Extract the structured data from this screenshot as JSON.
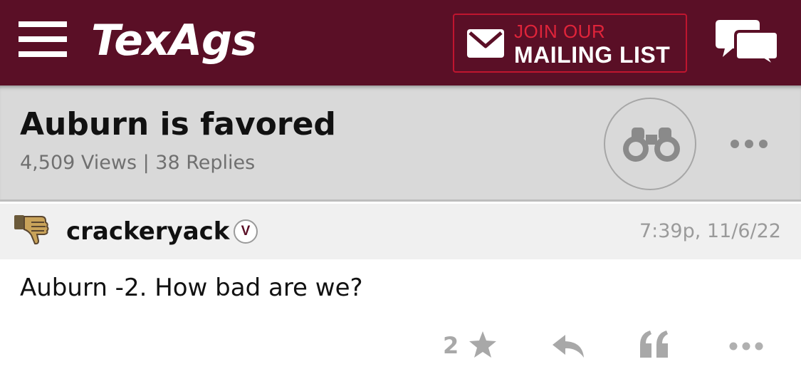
{
  "header": {
    "logo_text": "TexAgs",
    "mailing": {
      "line1": "JOIN OUR",
      "line2": "MAILING LIST"
    },
    "icons": {
      "menu": "hamburger-menu-icon",
      "mail": "envelope-icon",
      "chat": "chat-bubbles-icon"
    },
    "colors": {
      "background": "#5a0f26",
      "accent": "#e0243a"
    }
  },
  "thread": {
    "title": "Auburn is favored",
    "meta": "4,509 Views | 38 Replies",
    "icons": {
      "watch": "binoculars-icon",
      "more": "more-dots-icon"
    }
  },
  "post": {
    "username": "crackeryack",
    "badge": "V",
    "time": "7:39p, 11/6/22",
    "body": "Auburn -2. How bad are we?",
    "star_count": "2",
    "icons": {
      "avatar": "thumbs-down-avatar",
      "star": "star-icon",
      "reply": "reply-arrow-icon",
      "quote": "quote-icon",
      "more": "more-dots-icon"
    }
  }
}
